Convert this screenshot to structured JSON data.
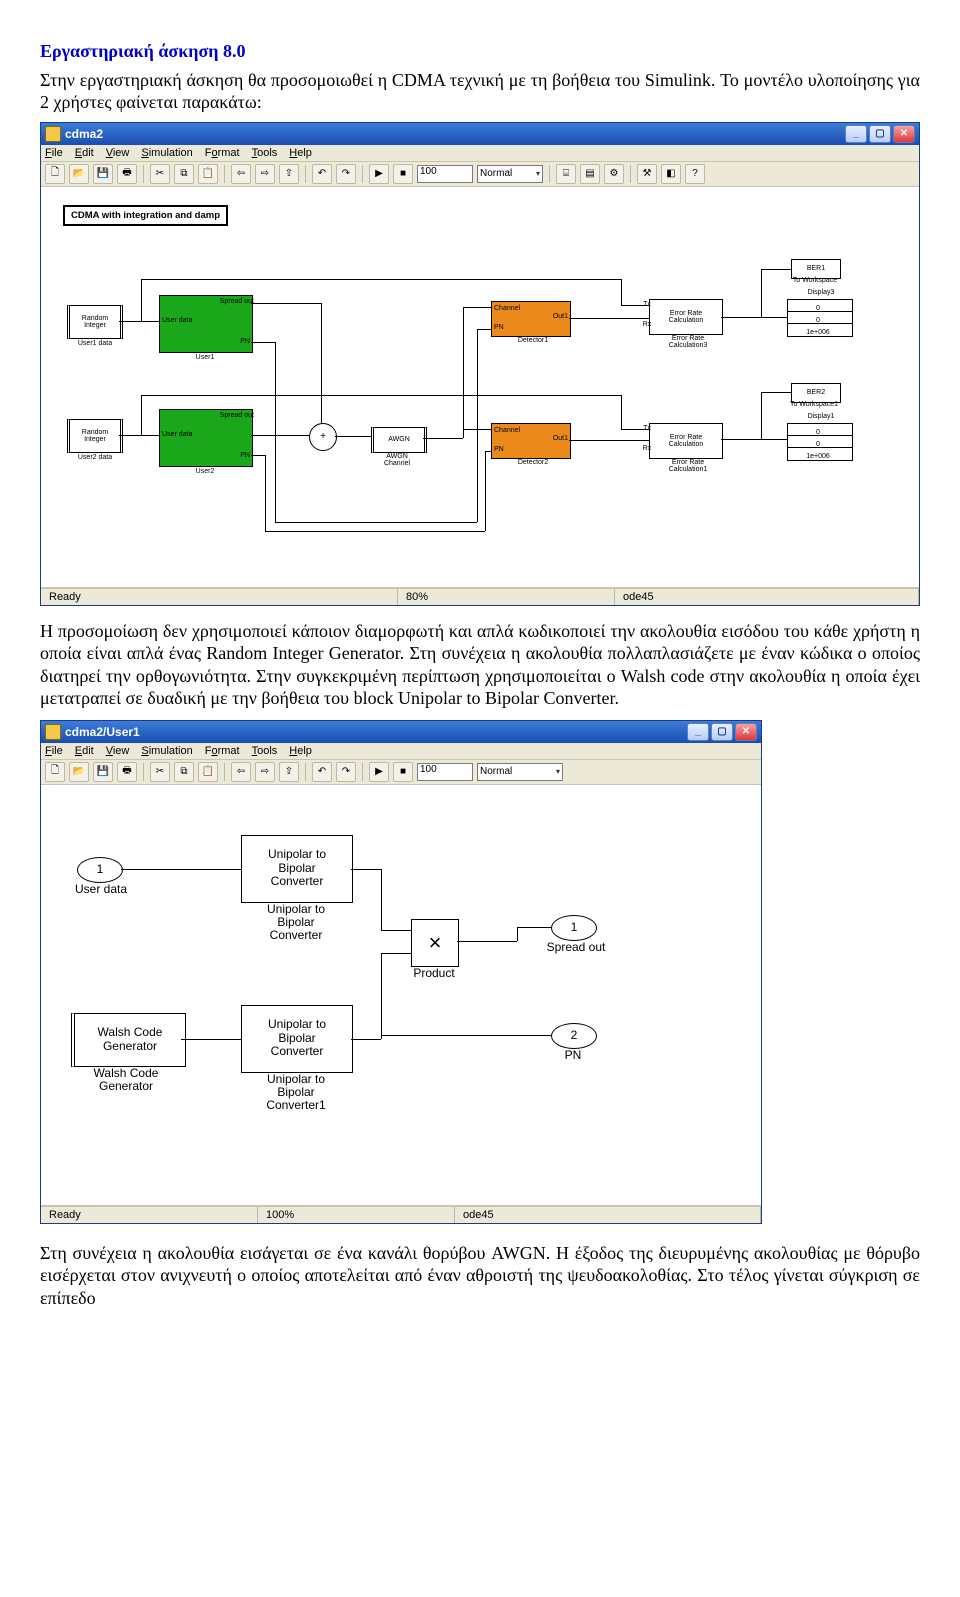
{
  "doc": {
    "title": "Εργαστηριακή άσκηση 8.0",
    "intro": "Στην εργαστηριακή άσκηση θα προσομοιωθεί η CDMA τεχνική με τη βοήθεια του Simulink. Το μοντέλο υλοποίησης για 2 χρήστες φαίνεται παρακάτω:",
    "mid": "Η προσομοίωση δεν χρησιμοποιεί κάποιον διαμορφωτή και απλά κωδικοποιεί την ακολουθία εισόδου του κάθε χρήστη η οποία είναι απλά ένας Random Integer Generator. Στη συνέχεια η ακολουθία πολλαπλασιάζετε με έναν κώδικα ο οποίος διατηρεί την ορθογωνιότητα. Στην συγκεκριμένη περίπτωση χρησιμοποιείται ο Walsh code στην ακολουθία η οποία έχει μετατραπεί σε δυαδική με την βοήθεια του block Unipolar to Bipolar Converter.",
    "bottom": "Στη συνέχεια η ακολουθία εισάγεται σε ένα κανάλι θορύβου AWGN. Η έξοδος της διευρυμένης ακολουθίας με θόρυβο εισέρχεται στον ανιχνευτή ο οποίος αποτελείται από έναν αθροιστή της ψευδοακολοθίας. Στο τέλος γίνεται σύγκριση σε επίπεδο"
  },
  "win1": {
    "title": "cdma2",
    "menu": [
      "File",
      "Edit",
      "View",
      "Simulation",
      "Format",
      "Tools",
      "Help"
    ],
    "stop_time": "100",
    "mode": "Normal",
    "status_ready": "Ready",
    "zoom": "80%",
    "solver": "ode45",
    "banner": "CDMA with integration and damp",
    "blocks": {
      "ri1": "Random\nInteger",
      "ri1_lbl": "User1 data",
      "ri2": "Random\nInteger",
      "ri2_lbl": "User2 data",
      "u1p1": "User data",
      "u1p2": "Spread out",
      "u1p3": "PN",
      "u1_lbl": "User1",
      "u2p1": "User data",
      "u2p2": "Spread out",
      "u2p3": "PN",
      "u2_lbl": "User2",
      "awgn": "AWGN",
      "awgn_lbl": "AWGN\nChannel",
      "ch1": "Channel",
      "ch1o": "Out1",
      "ch1p": "PN",
      "det1_lbl": "Detector1",
      "ch2": "Channel",
      "ch2o": "Out1",
      "ch2p": "PN",
      "det2_lbl": "Detector2",
      "erc": "Error Rate\nCalculation",
      "erc_t": "Tx",
      "erc_r": "Rx",
      "erc_lbl1": "Error Rate\nCalculation3",
      "erc_lbl2": "Error Rate\nCalculation1",
      "ber1": "BER1",
      "tows1": "To Workspace",
      "ber2": "BER2",
      "tows2": "To Workspace1",
      "disp0": "0",
      "dispN": "1e+006",
      "disp_lbl1": "Display3",
      "disp_lbl2": "Display1"
    }
  },
  "win2": {
    "title": "cdma2/User1",
    "menu": [
      "File",
      "Edit",
      "View",
      "Simulation",
      "Format",
      "Tools",
      "Help"
    ],
    "stop_time": "100",
    "mode": "Normal",
    "status_ready": "Ready",
    "zoom": "100%",
    "solver": "ode45",
    "blocks": {
      "in1": "1",
      "in1_lbl": "User data",
      "u2b": "Unipolar to\nBipolar\nConverter",
      "u2b_lbl": "Unipolar to\nBipolar\nConverter",
      "u2b1_lbl": "Unipolar to\nBipolar\nConverter1",
      "mult": "×",
      "mult_lbl": "Product",
      "out1": "1",
      "out1_lbl": "Spread out",
      "out2": "2",
      "out2_lbl": "PN",
      "walsh": "Walsh Code\nGenerator",
      "walsh_lbl": "Walsh Code\nGenerator"
    }
  }
}
